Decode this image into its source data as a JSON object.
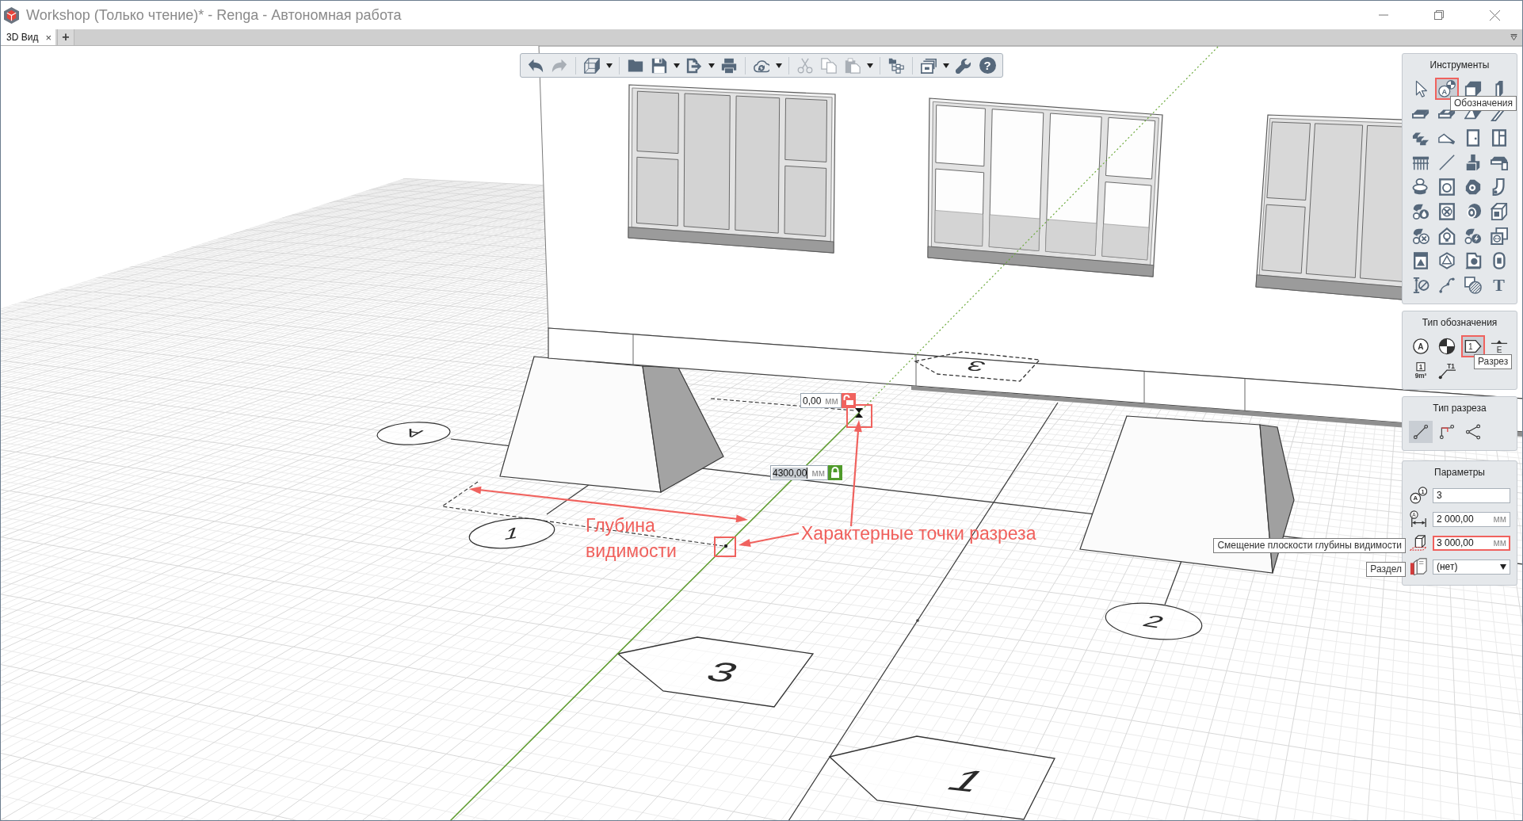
{
  "window": {
    "title": "Workshop (Только чтение)* - Renga - Автономная работа"
  },
  "tabs": {
    "items": [
      {
        "label": "3D Вид",
        "close": "×",
        "selected": true
      }
    ],
    "add": "+"
  },
  "toolbar": {
    "groups": [
      [
        {
          "kind": "undo",
          "disabled": false,
          "menu": false
        },
        {
          "kind": "redo",
          "disabled": true,
          "menu": false
        }
      ],
      [
        {
          "kind": "view",
          "disabled": false,
          "menu": true
        }
      ],
      [
        {
          "kind": "open",
          "disabled": false,
          "menu": false
        },
        {
          "kind": "save",
          "disabled": false,
          "menu": true
        },
        {
          "kind": "export",
          "disabled": false,
          "menu": true
        },
        {
          "kind": "print",
          "disabled": false,
          "menu": false
        }
      ],
      [
        {
          "kind": "sync",
          "disabled": false,
          "menu": true
        }
      ],
      [
        {
          "kind": "cut",
          "disabled": true,
          "menu": false
        },
        {
          "kind": "copy",
          "disabled": true,
          "menu": false
        },
        {
          "kind": "paste",
          "disabled": true,
          "menu": true
        }
      ],
      [
        {
          "kind": "structure",
          "disabled": false,
          "menu": false
        }
      ],
      [
        {
          "kind": "viewports",
          "disabled": false,
          "menu": true
        },
        {
          "kind": "settings",
          "disabled": false,
          "menu": false
        },
        {
          "kind": "help",
          "glyph": "?",
          "disabled": false,
          "menu": false
        }
      ]
    ]
  },
  "tools_panel": {
    "title": "Инструменты",
    "items": [
      {
        "kind": "select",
        "selected": false,
        "highlighted": false
      },
      {
        "kind": "annotation",
        "glyph": "A",
        "selected": true,
        "highlighted": true,
        "tooltip": "Обозначения"
      },
      {
        "kind": "wall",
        "selected": false,
        "highlighted": false
      },
      {
        "kind": "column",
        "selected": false,
        "highlighted": false
      },
      {
        "kind": "slab",
        "selected": false,
        "highlighted": false
      },
      {
        "kind": "opening",
        "selected": false,
        "highlighted": false
      },
      {
        "kind": "roof",
        "selected": false,
        "highlighted": false
      },
      {
        "kind": "beam",
        "selected": false,
        "highlighted": false
      },
      {
        "kind": "stairs",
        "selected": false,
        "highlighted": false
      },
      {
        "kind": "ramp",
        "selected": false,
        "highlighted": false
      },
      {
        "kind": "door",
        "selected": false,
        "highlighted": false
      },
      {
        "kind": "window",
        "selected": false,
        "highlighted": false
      },
      {
        "kind": "railing",
        "selected": false,
        "highlighted": false
      },
      {
        "kind": "line",
        "selected": false,
        "highlighted": false
      },
      {
        "kind": "equipment",
        "selected": false,
        "highlighted": false
      },
      {
        "kind": "duct",
        "selected": false,
        "highlighted": false
      },
      {
        "kind": "toilet",
        "selected": false,
        "highlighted": false
      },
      {
        "kind": "washer",
        "selected": false,
        "highlighted": false
      },
      {
        "kind": "pump",
        "selected": false,
        "highlighted": false
      },
      {
        "kind": "pipe",
        "selected": false,
        "highlighted": false
      },
      {
        "kind": "water",
        "selected": false,
        "highlighted": false
      },
      {
        "kind": "fan",
        "selected": false,
        "highlighted": false
      },
      {
        "kind": "drum",
        "selected": false,
        "highlighted": false
      },
      {
        "kind": "fitting",
        "selected": false,
        "highlighted": false
      },
      {
        "kind": "ventunit",
        "selected": false,
        "highlighted": false
      },
      {
        "kind": "lamp",
        "selected": false,
        "highlighted": false
      },
      {
        "kind": "power",
        "selected": false,
        "highlighted": false
      },
      {
        "kind": "socket",
        "selected": false,
        "highlighted": false
      },
      {
        "kind": "panel",
        "selected": false,
        "highlighted": false
      },
      {
        "kind": "solid",
        "selected": false,
        "highlighted": false
      },
      {
        "kind": "device",
        "selected": false,
        "highlighted": false
      },
      {
        "kind": "capsule",
        "selected": false,
        "highlighted": false
      },
      {
        "kind": "dimension",
        "selected": false,
        "highlighted": false
      },
      {
        "kind": "spline",
        "selected": false,
        "highlighted": false
      },
      {
        "kind": "hatch",
        "selected": false,
        "highlighted": false
      },
      {
        "kind": "text",
        "glyph": "T",
        "selected": false,
        "highlighted": false
      }
    ]
  },
  "annotation_type_panel": {
    "title": "Тип обозначения",
    "items": [
      {
        "kind": "axis",
        "glyph": "A",
        "selected": false,
        "highlighted": false
      },
      {
        "kind": "level",
        "selected": false,
        "highlighted": false
      },
      {
        "kind": "section",
        "glyph": "1",
        "selected": true,
        "highlighted": true,
        "tooltip": "Разрез"
      },
      {
        "kind": "elevation",
        "glyph": "E",
        "selected": false,
        "highlighted": false
      },
      {
        "kind": "room",
        "glyph": "1",
        "subglyph": "9m²",
        "selected": false,
        "highlighted": false
      },
      {
        "kind": "leader",
        "glyph": "T1",
        "selected": false,
        "highlighted": false
      }
    ]
  },
  "section_type_panel": {
    "title": "Тип разреза",
    "items": [
      {
        "kind": "straight",
        "selected": true
      },
      {
        "kind": "stepped",
        "selected": false
      },
      {
        "kind": "broken",
        "selected": false
      }
    ]
  },
  "parameters_panel": {
    "title": "Параметры",
    "rows": [
      {
        "kind": "number",
        "glyphs": [
          "A",
          "1"
        ],
        "value": "3",
        "highlighted": false
      },
      {
        "kind": "length",
        "glyphs": [
          "A"
        ],
        "value": "2 000,00",
        "unit": "мм",
        "highlighted": false
      },
      {
        "kind": "depth",
        "value": "3 000,00",
        "unit": "мм",
        "highlighted": true,
        "tooltip": "Смещение плоскости глубины видимости"
      },
      {
        "kind": "select",
        "value": "(нет)",
        "highlighted": false,
        "tooltip": "Раздел"
      }
    ]
  },
  "viewport": {
    "axis_marks": [
      {
        "label": "А"
      },
      {
        "label": "1"
      },
      {
        "label": "2"
      }
    ],
    "section_marks": [
      {
        "label": "3",
        "dashed": false
      },
      {
        "label": "1",
        "dashed": false
      },
      {
        "label": "3",
        "dashed": true
      }
    ],
    "dimension_inputs": [
      {
        "value": "0,00",
        "unit": "мм",
        "locked": false,
        "text_selected": false
      },
      {
        "value": "4300,00",
        "unit": "мм",
        "locked": true,
        "text_selected": true
      }
    ],
    "callouts": [
      {
        "text": "Глубина видимости"
      },
      {
        "text": "Характерные точки разреза"
      }
    ]
  }
}
